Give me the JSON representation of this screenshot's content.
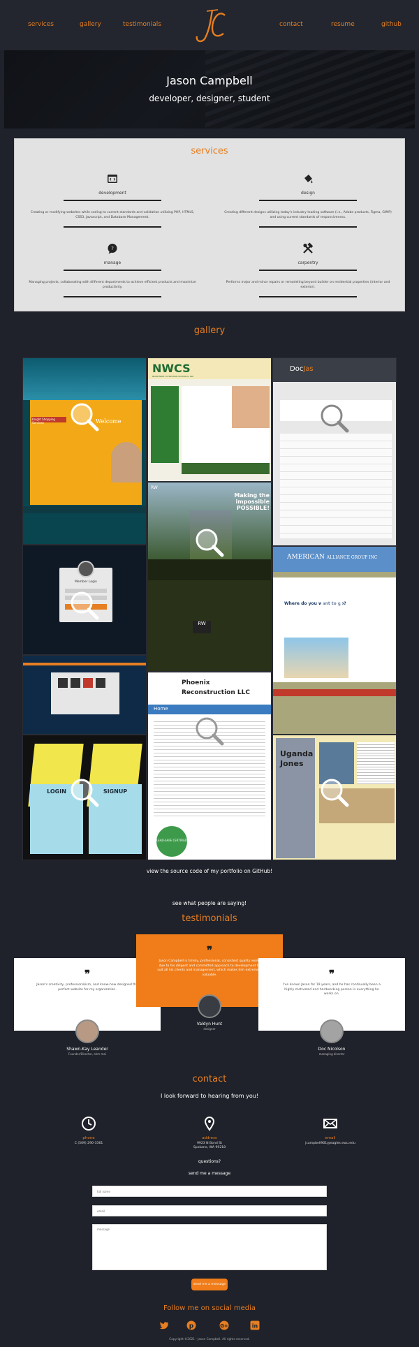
{
  "nav": {
    "services": "services",
    "gallery": "gallery",
    "testimonials": "testimonials",
    "contact": "contact",
    "resume": "resume",
    "github": "github",
    "logo": "JC"
  },
  "hero": {
    "name": "Jason Campbell",
    "tagline": "developer, designer, student"
  },
  "services": {
    "title": "services",
    "items": [
      {
        "name": "development",
        "icon": "browser-code-icon",
        "desc": "Creating or modifying websites while coding to current standards and validation utilizing PHP, HTML5, CSS3, Javascript, and Database Management."
      },
      {
        "name": "design",
        "icon": "paint-bucket-icon",
        "desc": "Creating different designs utilizing today's industry-leading software (i.e., Adobe products, Figma, GIMP) and using current standards of responsiveness."
      },
      {
        "name": "manage",
        "icon": "speech-bubble-icon",
        "desc": "Managing projects, collaborating with different departments to achieve efficient products and maximize productivity."
      },
      {
        "name": "carpentry",
        "icon": "hammer-wrench-icon",
        "desc": "Performs major and minor repairs or remodeling beyond builder on residential properties (interior and exterior)."
      }
    ]
  },
  "gallery": {
    "title": "gallery",
    "github_link": "view the source code of my portfolio on GitHub!",
    "tiles": {
      "t1_brand": "Knight Shopping Services",
      "t1_welcome": "Welcome",
      "t2_brand": "NWCS",
      "t2_sub": "NORTHWEST CHRISTIAN SCHOOLS, INC.",
      "t3_brand": "Doc",
      "t3_brand2": "Jas",
      ".com": ".com",
      "t4_sub": "Member Login",
      "t5_rw": "RW",
      "t5_slogan": "Making the impossible POSSIBLE!",
      "t6_brand": "AMERICAN",
      "t6_brand2": "ALLIANCE GROUP INC",
      "t6_q": "Where do you want to go?",
      "t8_brand": "Phoenix",
      "t8_brand2": "Reconstruction LLC",
      "t8_home": "Home",
      "t8_seal": "LEAD-SAFE CERTIFIED",
      "t9_login": "LOGIN",
      "t9_signup": "SIGNUP",
      "t10_name1": "Uganda",
      "t10_name2": "Jones"
    }
  },
  "testimonials": {
    "intro": "see what people are saying!",
    "title": "testimonials",
    "items": [
      {
        "text": "Jason's creativity, professionalism, and know-how designed the perfect website for my organization.",
        "name": "Shawn-Kay Leander",
        "role": "Founder/Director, ohm mai"
      },
      {
        "text": "Jason Campbell is timely, professional, consistent quality work, due to his diligent and committed approach to development to suit all his clients and management, which makes him extremely valuable.",
        "name": "Valdyn Hunt",
        "role": "designer"
      },
      {
        "text": "I've known Jason for 19 years, and he has continually been a highly motivated and hardworking person in everything he works on.",
        "name": "Doc Nicolson",
        "role": "managing director"
      }
    ]
  },
  "contact": {
    "title": "contact",
    "subtitle": "I look forward to hearing from you!",
    "phone_label": "phone",
    "phone_value": "C (509) 290-3361",
    "address_label": "address",
    "address_line1": "9923 N Bond St",
    "address_line2": "Spokane, WA 99218",
    "email_label": "email",
    "email_value": "jcampbell901@eagles.ewu.edu",
    "questions": "questions?",
    "send_title": "send me a message",
    "name_placeholder": "full name",
    "email_placeholder": "email",
    "message_placeholder": "message",
    "submit": "send me a message"
  },
  "social": {
    "title": "Follow me on social media",
    "copyright": "Copyright ©2021 - Jason Campbell. All rights reserved."
  },
  "colors": {
    "accent": "#e67e22",
    "bg": "#1f222a"
  }
}
